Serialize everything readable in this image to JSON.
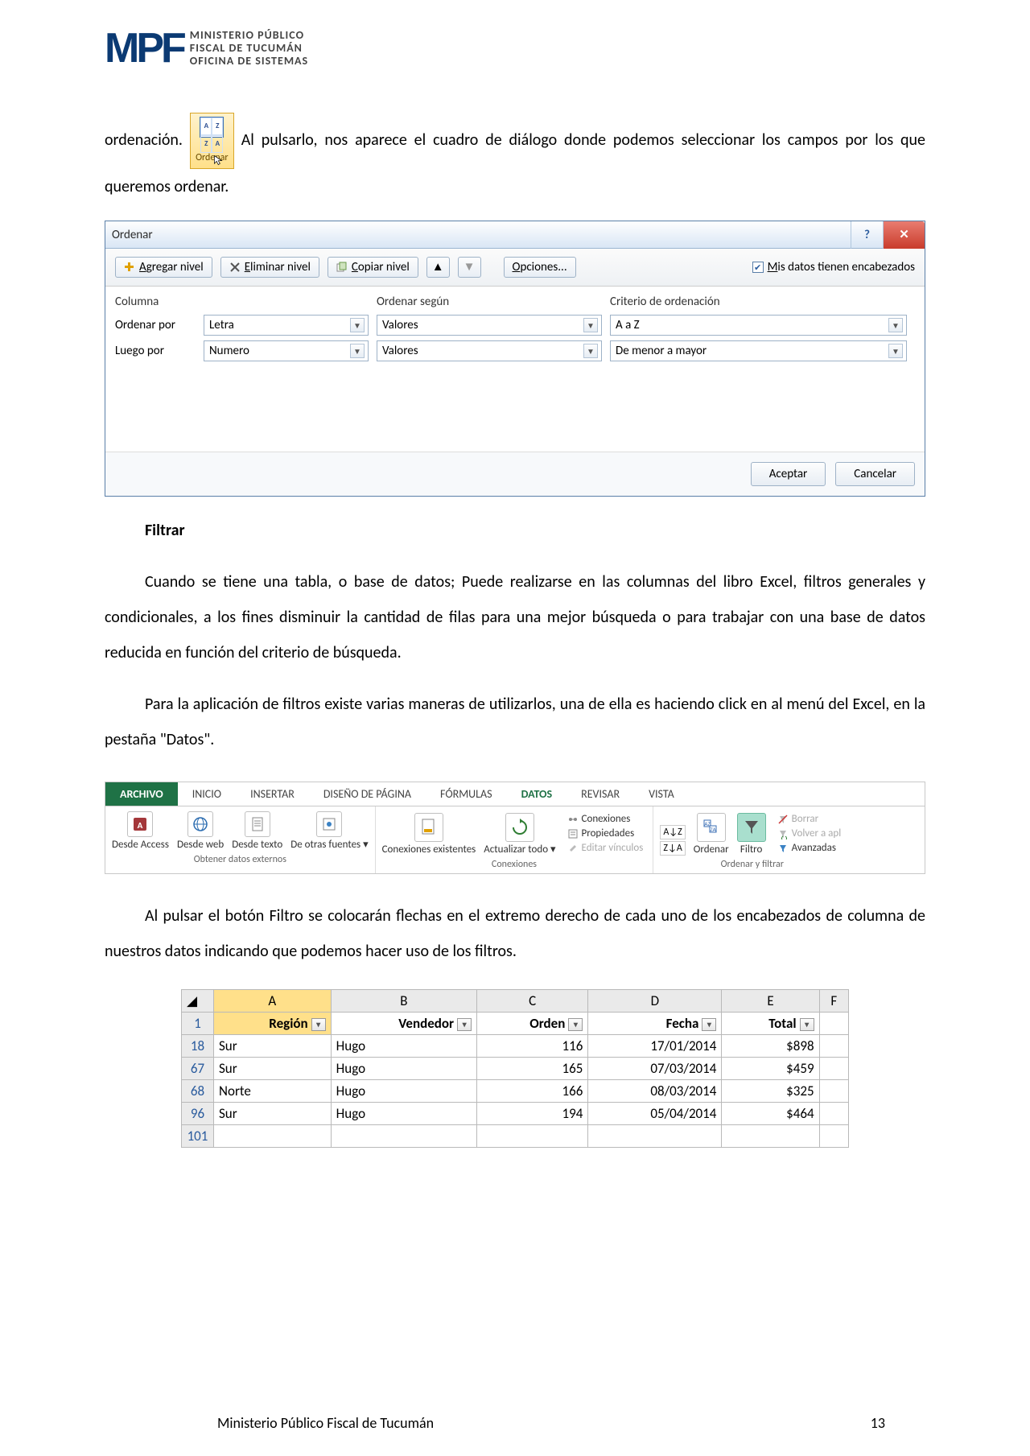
{
  "header": {
    "logo": "MPF",
    "line1": "MINISTERIO PÚBLICO",
    "line2": "FISCAL DE TUCUMÁN",
    "line3": "OFICINA DE SISTEMAS"
  },
  "inline_icon": {
    "label": "Ordenar"
  },
  "para1a": "ordenación.",
  "para1b": "Al pulsarlo, nos aparece el cuadro de diálogo donde podemos seleccionar los campos por los que queremos ordenar.",
  "dialog": {
    "title": "Ordenar",
    "btn_add": "Agregar nivel",
    "btn_del": "Eliminar nivel",
    "btn_copy": "Copiar nivel",
    "btn_options": "Opciones...",
    "chk_headers": "Mis datos tienen encabezados",
    "col_hdr1": "Columna",
    "col_hdr2": "Ordenar según",
    "col_hdr3": "Criterio de ordenación",
    "rows": [
      {
        "label": "Ordenar por",
        "col": "Letra",
        "by": "Valores",
        "crit": "A a Z"
      },
      {
        "label": "Luego por",
        "col": "Numero",
        "by": "Valores",
        "crit": "De menor a mayor"
      }
    ],
    "btn_ok": "Aceptar",
    "btn_cancel": "Cancelar"
  },
  "section2_title": "Filtrar",
  "section2_p1": "Cuando se tiene una tabla, o base de datos; Puede realizarse en las columnas del libro Excel, filtros generales y condicionales, a los fines disminuir la cantidad de filas para una mejor búsqueda o para trabajar con una base de datos reducida en función del criterio de búsqueda.",
  "section2_p2": "Para la aplicación de filtros existe varias maneras de utilizarlos, una de ella es haciendo click en al menú del Excel, en la pestaña \"Datos\".",
  "ribbon": {
    "tabs": [
      "ARCHIVO",
      "INICIO",
      "INSERTAR",
      "DISEÑO DE PÁGINA",
      "FÓRMULAS",
      "DATOS",
      "REVISAR",
      "VISTA"
    ],
    "group_ext": {
      "items": [
        "Desde Access",
        "Desde web",
        "Desde texto",
        "De otras fuentes"
      ],
      "label": "Obtener datos externos"
    },
    "group_conn": {
      "btn1": "Conexiones existentes",
      "btn2": "Actualizar todo",
      "links": [
        "Conexiones",
        "Propiedades",
        "Editar vínculos"
      ],
      "label": "Conexiones"
    },
    "group_sort": {
      "btn_sort": "Ordenar",
      "btn_filter": "Filtro",
      "links": [
        "Borrar",
        "Volver a apl",
        "Avanzadas"
      ],
      "label": "Ordenar y filtrar"
    }
  },
  "section3_p": "Al pulsar el botón Filtro se colocarán flechas en el extremo derecho de cada uno de los encabezados de columna de nuestros datos indicando que podemos hacer uso de los filtros.",
  "xtable": {
    "cols": [
      "A",
      "B",
      "C",
      "D",
      "E",
      "F"
    ],
    "headers": [
      "Región",
      "Vendedor",
      "Orden",
      "Fecha",
      "Total",
      ""
    ],
    "rows": [
      {
        "n": "18",
        "c": [
          "Sur",
          "Hugo",
          "116",
          "17/01/2014",
          "$898",
          ""
        ]
      },
      {
        "n": "67",
        "c": [
          "Sur",
          "Hugo",
          "165",
          "07/03/2014",
          "$459",
          ""
        ]
      },
      {
        "n": "68",
        "c": [
          "Norte",
          "Hugo",
          "166",
          "08/03/2014",
          "$325",
          ""
        ]
      },
      {
        "n": "96",
        "c": [
          "Sur",
          "Hugo",
          "194",
          "05/04/2014",
          "$464",
          ""
        ]
      },
      {
        "n": "101",
        "c": [
          "",
          "",
          "",
          "",
          "",
          ""
        ]
      }
    ]
  },
  "footer": {
    "text": "Ministerio Público Fiscal de Tucumán",
    "page": "13"
  }
}
